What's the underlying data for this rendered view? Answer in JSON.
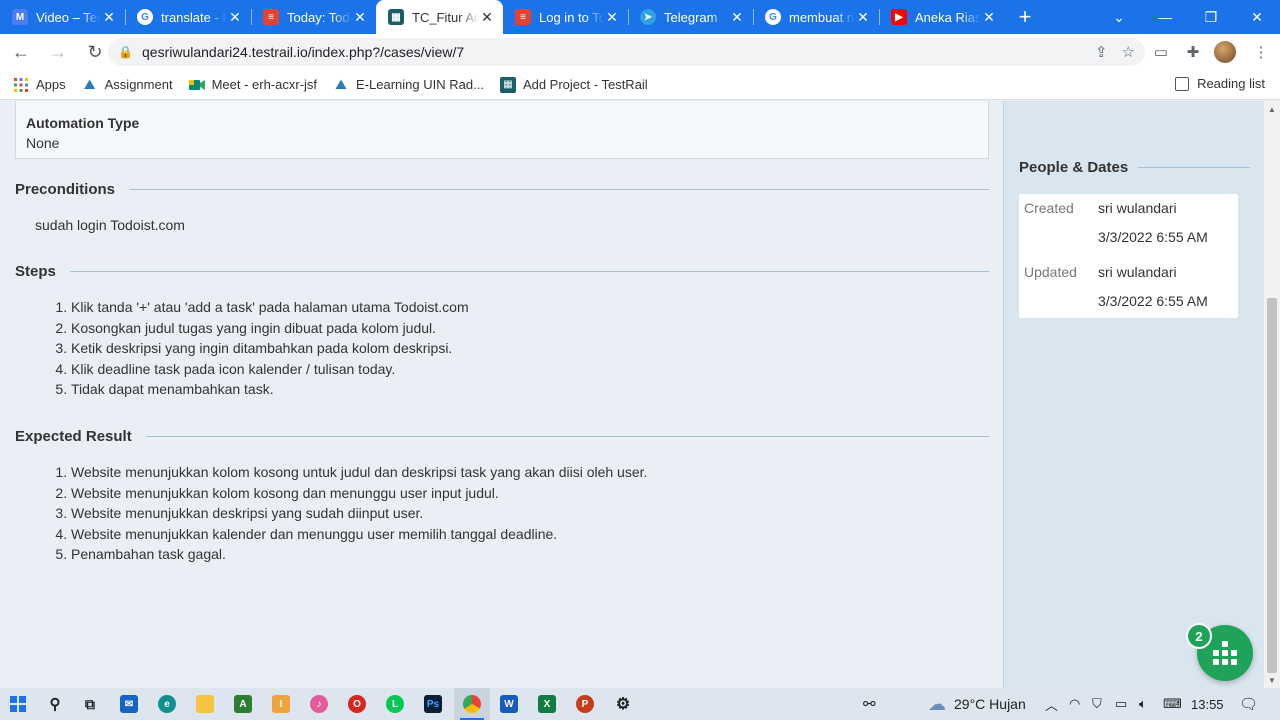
{
  "browser": {
    "tabs": [
      {
        "title": "Video – Testing",
        "icon": "m-icon",
        "color": "#4c7cf0"
      },
      {
        "title": "translate - Penelusuran",
        "icon": "google-icon",
        "color": "#ffffff"
      },
      {
        "title": "Today: Todoist",
        "icon": "todoist-icon",
        "color": "#e44332"
      },
      {
        "title": "TC_Fitur Add Task",
        "icon": "testrail-icon",
        "color": "#1b5e6a"
      },
      {
        "title": "Log in to Todoist",
        "icon": "todoist-icon",
        "color": "#e44332"
      },
      {
        "title": "Telegram",
        "icon": "telegram-icon",
        "color": "#2aa3e0"
      },
      {
        "title": "membuat nama",
        "icon": "google-icon",
        "color": "#ffffff"
      },
      {
        "title": "Aneka Riasan",
        "icon": "youtube-icon",
        "color": "#ff0000"
      }
    ],
    "active_tab_index": 3,
    "new_tab": "+",
    "url": "qesriwulandari24.testrail.io/index.php?/cases/view/7",
    "bookmarks": [
      {
        "label": "Apps",
        "icon": "apps-grid-icon"
      },
      {
        "label": "Assignment",
        "icon": "elearning-icon"
      },
      {
        "label": "Meet - erh-acxr-jsf",
        "icon": "meet-icon"
      },
      {
        "label": "E-Learning UIN Rad...",
        "icon": "elearning-icon"
      },
      {
        "label": "Add Project - TestRail",
        "icon": "testrail-icon"
      }
    ],
    "reading_list": "Reading list"
  },
  "page": {
    "automation_type": {
      "label": "Automation Type",
      "value": "None"
    },
    "preconditions": {
      "title": "Preconditions",
      "text": "sudah login Todoist.com"
    },
    "steps": {
      "title": "Steps",
      "items": [
        "Klik tanda '+' atau 'add a task' pada halaman utama Todoist.com",
        "Kosongkan judul tugas yang ingin dibuat pada kolom judul.",
        "Ketik deskripsi yang ingin ditambahkan pada kolom deskripsi.",
        "Klik deadline task pada icon kalender / tulisan today.",
        "Tidak dapat menambahkan task."
      ]
    },
    "expected": {
      "title": "Expected Result",
      "items": [
        "Website menunjukkan kolom kosong untuk judul dan deskripsi task yang akan diisi oleh user.",
        "Website menunjukkan kolom kosong dan menunggu user input judul.",
        "Website menunjukkan deskripsi yang sudah diinput user.",
        "Website menunjukkan kalender dan menunggu user memilih tanggal deadline.",
        "Penambahan task gagal."
      ]
    },
    "people_dates": {
      "title": "People & Dates",
      "created_label": "Created",
      "created_by": "sri wulandari",
      "created_at": "3/3/2022 6:55 AM",
      "updated_label": "Updated",
      "updated_by": "sri wulandari",
      "updated_at": "3/3/2022 6:55 AM"
    },
    "help_badge": "2"
  },
  "taskbar": {
    "weather": "29°C  Hujan",
    "time": "13:55"
  },
  "colors": {
    "chrome_blue": "#1a73e8",
    "page_bg": "#e9eff4",
    "sidebar_bg": "#d9e6ef",
    "fab_green": "#1fa35a"
  }
}
